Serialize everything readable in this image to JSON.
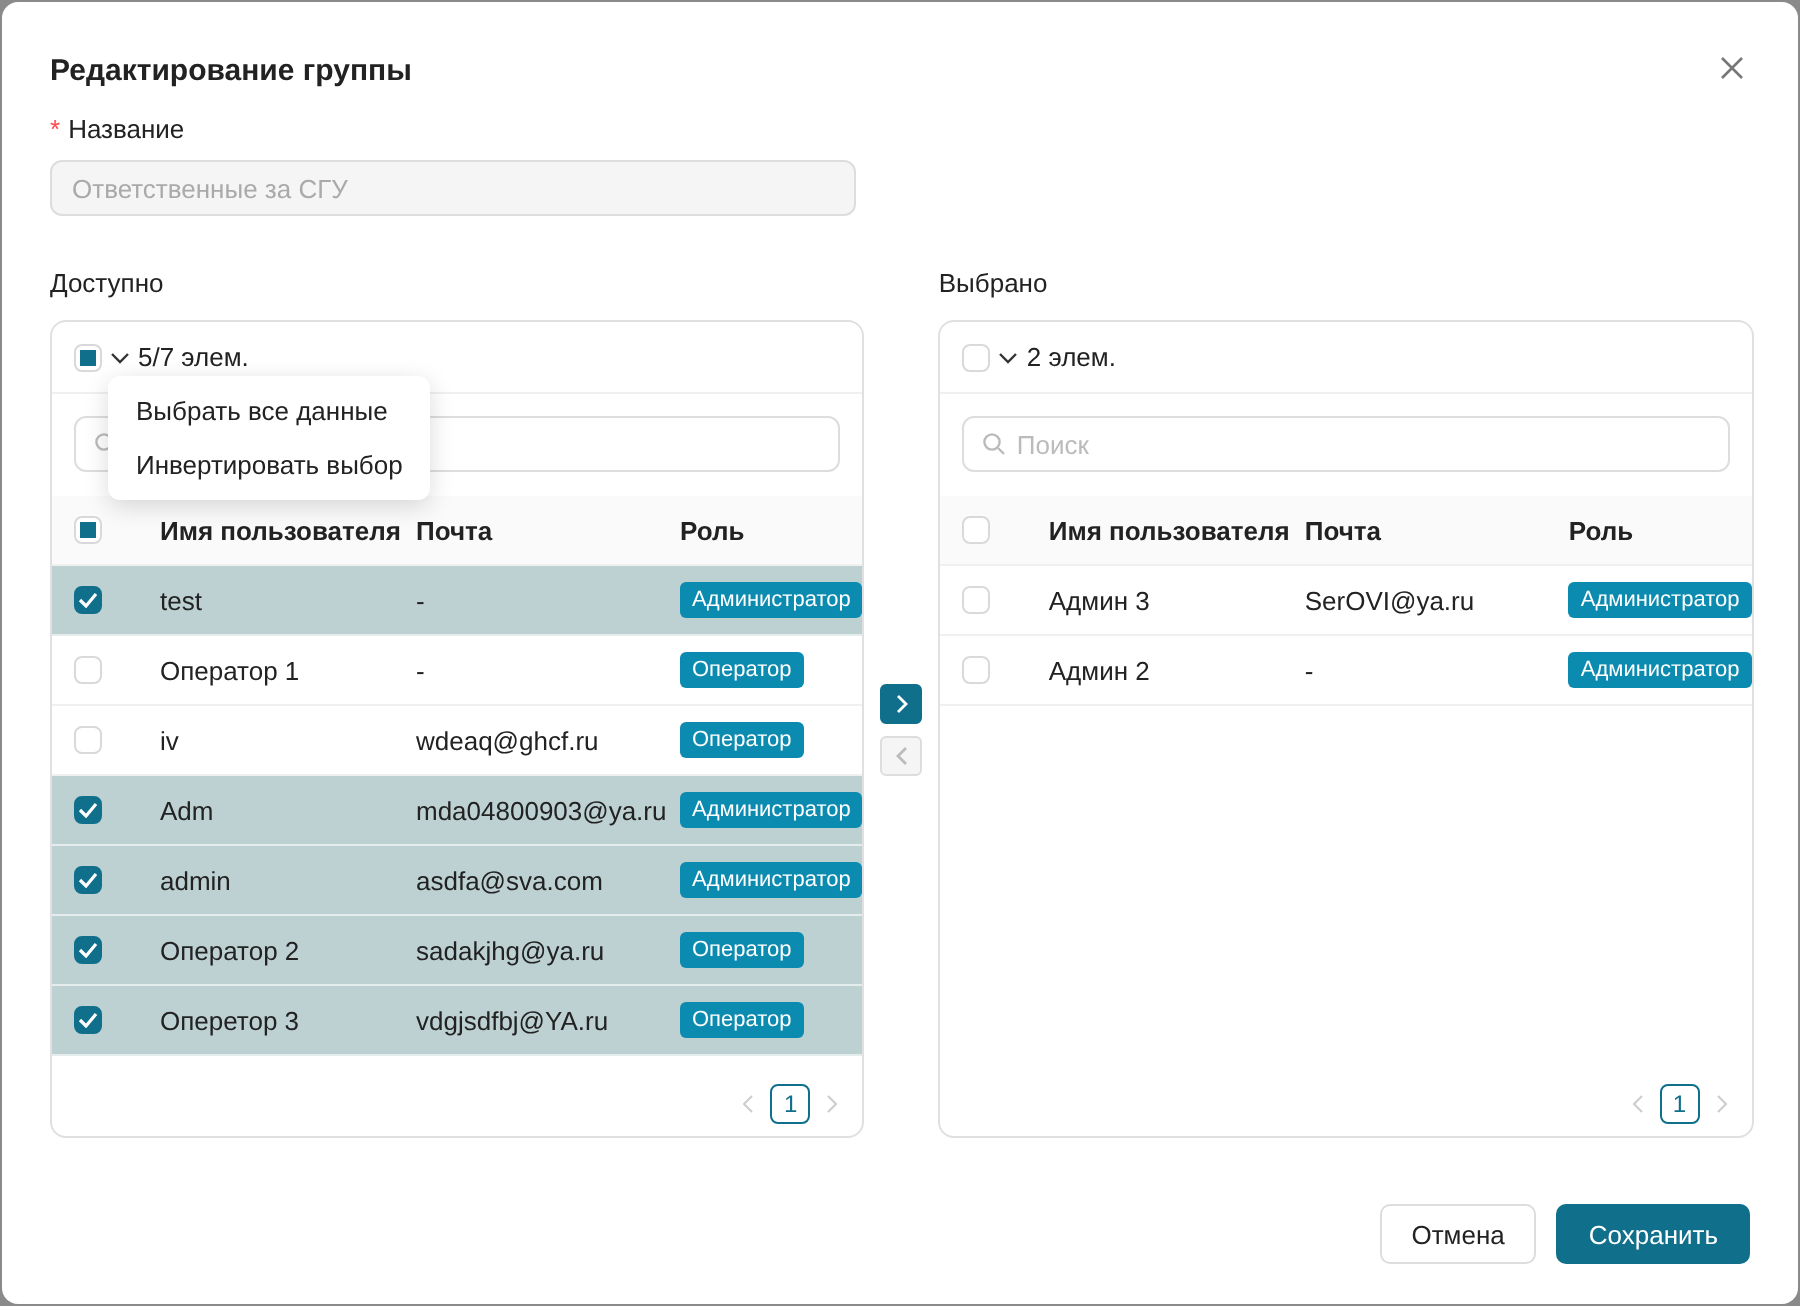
{
  "dialog": {
    "title": "Редактирование группы"
  },
  "name_field": {
    "required_mark": "*",
    "label": "Название",
    "value": "Ответственные за СГУ",
    "disabled": true
  },
  "panels": [
    {
      "label": "Доступно",
      "header_checked": false,
      "header_indeterminate": true,
      "count": "5/7 элем.",
      "menu": {
        "items": [
          "Выбрать все данные",
          "Инвертировать выбор"
        ]
      },
      "columns": [
        "Имя пользователя",
        "Почта",
        "Роль"
      ],
      "rows": [
        {
          "name": "test",
          "email": "-",
          "role": "Администратор",
          "selected": true
        },
        {
          "name": "Оператор 1",
          "email": "-",
          "role": "Оператор",
          "selected": false
        },
        {
          "name": "iv",
          "email": "wdeaq@ghcf.ru",
          "role": "Оператор",
          "selected": false
        },
        {
          "name": "Adm",
          "email": "mda04800903@ya.ru",
          "role": "Администратор",
          "selected": true
        },
        {
          "name": "admin",
          "email": "asdfa@sva.com",
          "role": "Администратор",
          "selected": true
        },
        {
          "name": "Оператор 2",
          "email": "sadakjhg@ya.ru",
          "role": "Оператор",
          "selected": true
        },
        {
          "name": "Оперетор 3",
          "email": "vdgjsdfbj@YA.ru",
          "role": "Оператор",
          "selected": true
        }
      ],
      "page": "1"
    },
    {
      "label": "Выбрано",
      "header_checked": false,
      "header_indeterminate": false,
      "count": "2 элем.",
      "search": {
        "placeholder": "Поиск"
      },
      "columns": [
        "Имя пользователя",
        "Почта",
        "Роль"
      ],
      "rows": [
        {
          "name": "Админ 3",
          "email": "SerOVI@ya.ru",
          "role": "Администратор",
          "selected": false
        },
        {
          "name": "Админ 2",
          "email": "-",
          "role": "Администратор",
          "selected": false
        }
      ],
      "page": "1"
    }
  ],
  "transfer": {
    "to_right_disabled": false,
    "to_left_disabled": true
  },
  "buttons": [
    {
      "label": "Отмена",
      "kind": "default"
    },
    {
      "label": "Сохранить",
      "kind": "primary"
    }
  ]
}
